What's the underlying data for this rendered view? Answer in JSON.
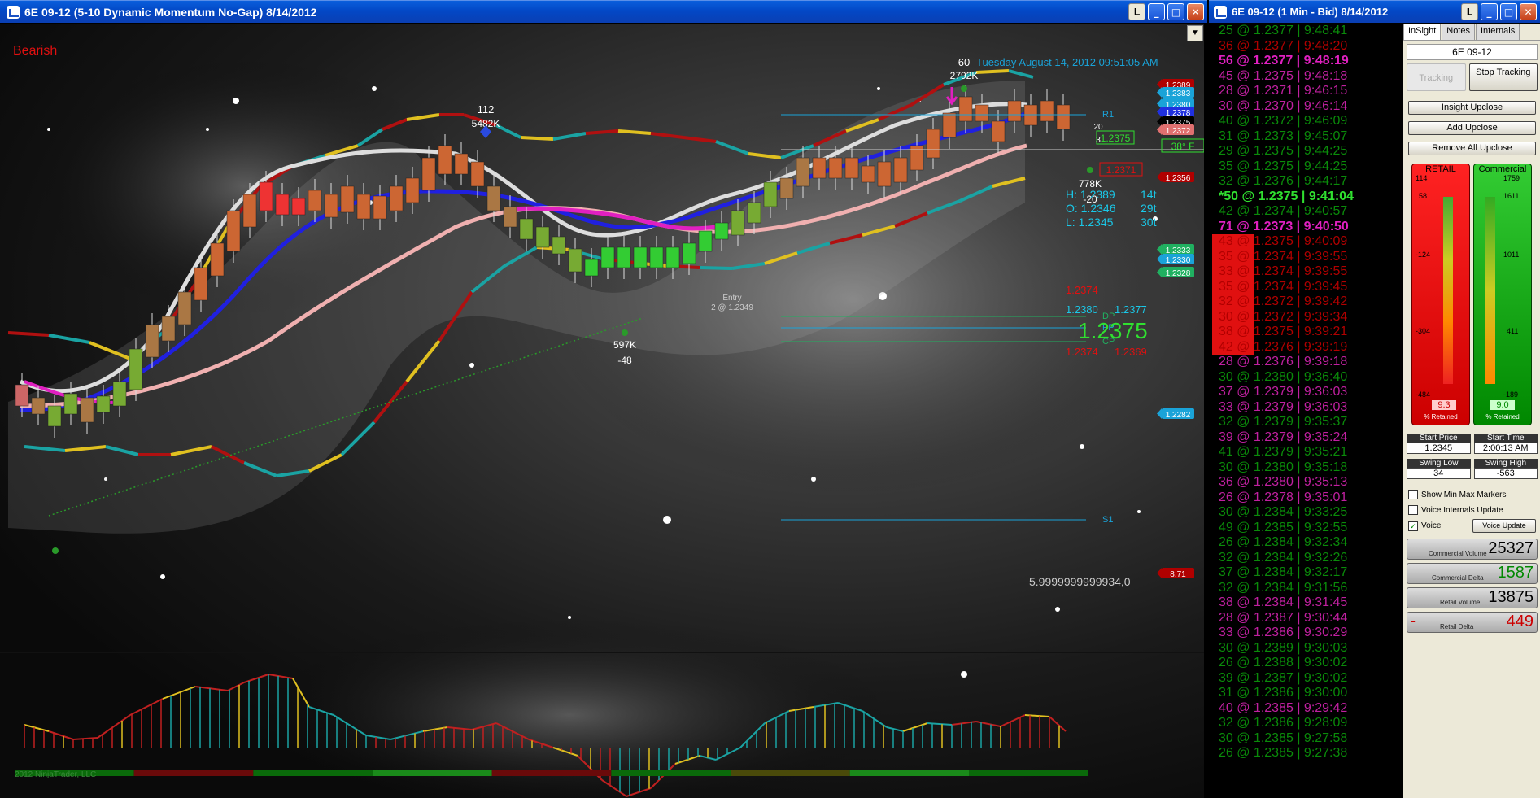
{
  "chart_window": {
    "title": "6E 09-12 (5-10 Dynamic Momentum No-Gap)  8/14/2012",
    "btn_l": "L",
    "btn_min": "_",
    "btn_max": "□",
    "btn_close": "✕",
    "bias": "Bearish",
    "datetime": "Tuesday August 14, 2012 09:51:05 AM",
    "price_tags": [
      {
        "label": "1.2389",
        "color": "#b00000"
      },
      {
        "label": "1.2383",
        "color": "#1aa3d8"
      },
      {
        "label": "1.2380",
        "color": "#1aa3d8"
      },
      {
        "label": "1.2378",
        "color": "#2030e0"
      },
      {
        "label": "1.2375",
        "color": "#000000"
      },
      {
        "label": "1.2372",
        "color": "#e07070"
      },
      {
        "label": "1.2356",
        "color": "#b00000"
      },
      {
        "label": "1.2333",
        "color": "#20b060"
      },
      {
        "label": "1.2330",
        "color": "#1aa3d8"
      },
      {
        "label": "1.2328",
        "color": "#20b060"
      },
      {
        "label": "1.2282",
        "color": "#1aa3d8"
      },
      {
        "label": "8.71",
        "color": "#b00000"
      }
    ],
    "hol": {
      "h": "H: 1.2389",
      "h_t": "14t",
      "o": "O: 1.2346",
      "o_t": "29t",
      "l": "L: 1.2345",
      "l_t": "30t"
    },
    "levels": {
      "r1": "R1",
      "dp": "DP",
      "pp": "PP",
      "cp": "CP",
      "s1": "S1"
    },
    "pivot_vals": {
      "v1": "1.2374",
      "v2": "1.2380",
      "v3": "1.2377",
      "big": "1.2375",
      "v4": "1.2374",
      "v5": "1.2369"
    },
    "annotations": {
      "a112": "112",
      "a5482": "5482K",
      "a60": "60",
      "a2792": "2792K",
      "a597": "597K",
      "a48": "-48",
      "a778": "778K",
      "a20": "-20",
      "entry": "Entry",
      "entry2": "2 @ 1.2349",
      "temp": "38° F",
      "tag2375": "1.2375",
      "tag2371": "1.2371",
      "sm3": "3",
      "sm20": "20"
    },
    "scale_val": "5.9999999999934,0",
    "copyright": "2012 NinjaTrader, LLC"
  },
  "tape_window": {
    "title": "6E 09-12 (1 Min - Bid)  8/14/2012",
    "rows": [
      {
        "t": "25 @ 1.2377 | 9:48:41",
        "c": "#0a8a0a"
      },
      {
        "t": "36 @ 1.2377 | 9:48:20",
        "c": "#b00000"
      },
      {
        "t": "56 @ 1.2377 | 9:48:19",
        "c": "#e020c0",
        "b": true
      },
      {
        "t": "45 @ 1.2375 | 9:48:18",
        "c": "#c020a0"
      },
      {
        "t": "28 @ 1.2371 | 9:46:15",
        "c": "#c020a0"
      },
      {
        "t": "30 @ 1.2370 | 9:46:14",
        "c": "#c020a0"
      },
      {
        "t": "40 @ 1.2372 | 9:46:09",
        "c": "#0a8a0a"
      },
      {
        "t": "31 @ 1.2373 | 9:45:07",
        "c": "#0a8a0a"
      },
      {
        "t": "29 @ 1.2375 | 9:44:25",
        "c": "#0a8a0a"
      },
      {
        "t": "35 @ 1.2375 | 9:44:25",
        "c": "#0a8a0a"
      },
      {
        "t": "32 @ 1.2376 | 9:44:17",
        "c": "#0a8a0a"
      },
      {
        "t": "*50 @ 1.2375 | 9:41:04",
        "c": "#30e030",
        "b": true
      },
      {
        "t": "42 @ 1.2374 | 9:40:57",
        "c": "#0a8a0a"
      },
      {
        "t": "71 @ 1.2373 | 9:40:50",
        "c": "#e020c0",
        "b": true
      },
      {
        "t": "43 @ 1.2375 | 9:40:09",
        "c": "#b00000"
      },
      {
        "t": "35 @ 1.2374 | 9:39:55",
        "c": "#b00000"
      },
      {
        "t": "33 @ 1.2374 | 9:39:55",
        "c": "#b00000"
      },
      {
        "t": "35 @ 1.2374 | 9:39:45",
        "c": "#b00000"
      },
      {
        "t": "32 @ 1.2372 | 9:39:42",
        "c": "#b00000"
      },
      {
        "t": "30 @ 1.2372 | 9:39:34",
        "c": "#b00000"
      },
      {
        "t": "38 @ 1.2375 | 9:39:21",
        "c": "#b00000"
      },
      {
        "t": "42 @ 1.2376 | 9:39:19",
        "c": "#b00000"
      },
      {
        "t": "28 @ 1.2376 | 9:39:18",
        "c": "#c020a0"
      },
      {
        "t": "30 @ 1.2380 | 9:36:40",
        "c": "#0a8a0a"
      },
      {
        "t": "37 @ 1.2379 | 9:36:03",
        "c": "#c020a0"
      },
      {
        "t": "33 @ 1.2379 | 9:36:03",
        "c": "#c020a0"
      },
      {
        "t": "32 @ 1.2379 | 9:35:37",
        "c": "#0a8a0a"
      },
      {
        "t": "39 @ 1.2379 | 9:35:24",
        "c": "#c020a0"
      },
      {
        "t": "41 @ 1.2379 | 9:35:21",
        "c": "#0a8a0a"
      },
      {
        "t": "30 @ 1.2380 | 9:35:18",
        "c": "#0a8a0a"
      },
      {
        "t": "36 @ 1.2380 | 9:35:13",
        "c": "#c020a0"
      },
      {
        "t": "26 @ 1.2378 | 9:35:01",
        "c": "#c020a0"
      },
      {
        "t": "30 @ 1.2384 | 9:33:25",
        "c": "#0a8a0a"
      },
      {
        "t": "49 @ 1.2385 | 9:32:55",
        "c": "#0a8a0a"
      },
      {
        "t": "26 @ 1.2384 | 9:32:34",
        "c": "#0a8a0a"
      },
      {
        "t": "32 @ 1.2384 | 9:32:26",
        "c": "#0a8a0a"
      },
      {
        "t": "37 @ 1.2384 | 9:32:17",
        "c": "#0a8a0a"
      },
      {
        "t": "32 @ 1.2384 | 9:31:56",
        "c": "#0a8a0a"
      },
      {
        "t": "38 @ 1.2384 | 9:31:45",
        "c": "#c020a0"
      },
      {
        "t": "28 @ 1.2387 | 9:30:44",
        "c": "#c020a0"
      },
      {
        "t": "33 @ 1.2386 | 9:30:29",
        "c": "#c020a0"
      },
      {
        "t": "30 @ 1.2389 | 9:30:03",
        "c": "#0a8a0a"
      },
      {
        "t": "26 @ 1.2388 | 9:30:02",
        "c": "#0a8a0a"
      },
      {
        "t": "39 @ 1.2387 | 9:30:02",
        "c": "#0a8a0a"
      },
      {
        "t": "31 @ 1.2386 | 9:30:00",
        "c": "#0a8a0a"
      },
      {
        "t": "40 @ 1.2385 | 9:29:42",
        "c": "#c020a0"
      },
      {
        "t": "32 @ 1.2386 | 9:28:09",
        "c": "#0a8a0a"
      },
      {
        "t": "30 @ 1.2385 | 9:27:58",
        "c": "#0a8a0a"
      },
      {
        "t": "26 @ 1.2385 | 9:27:38",
        "c": "#0a8a0a"
      }
    ]
  },
  "insight_panel": {
    "tabs": [
      "InSight",
      "Notes",
      "Internals"
    ],
    "symbol": "6E 09-12",
    "tracking": "Tracking",
    "stop_tracking": "Stop Tracking",
    "insight_upclose": "Insight Upclose",
    "add_upclose": "Add Upclose",
    "remove_all": "Remove All Upclose",
    "retail": {
      "label": "RETAIL",
      "top": "114",
      "t1": "58",
      "t2": "-124",
      "t3": "-304",
      "bottom": "-484",
      "value": "9.3",
      "caption": "% Retained"
    },
    "commercial": {
      "label": "Commercial",
      "top": "1759",
      "t1": "1611",
      "t2": "1011",
      "t3": "411",
      "bottom": "-189",
      "value": "9.0",
      "caption": "% Retained"
    },
    "start_price_label": "Start Price",
    "start_price": "1.2345",
    "start_time_label": "Start Time",
    "start_time": "2:00:13 AM",
    "swing_low_label": "Swing Low",
    "swing_low": "34",
    "swing_high_label": "Swing High",
    "swing_high": "-563",
    "show_min_max": "Show Min Max Markers",
    "voice_internals": "Voice Internals Update",
    "voice": "Voice",
    "voice_update": "Voice Update",
    "commercial_volume_label": "Commercial Volume",
    "commercial_volume": "25327",
    "commercial_delta_label": "Commercial Delta",
    "commercial_delta": "1587",
    "retail_volume_label": "Retail Volume",
    "retail_volume": "13875",
    "retail_delta_label": "Retail Delta",
    "retail_delta": "449",
    "retail_delta_sign": "-"
  }
}
